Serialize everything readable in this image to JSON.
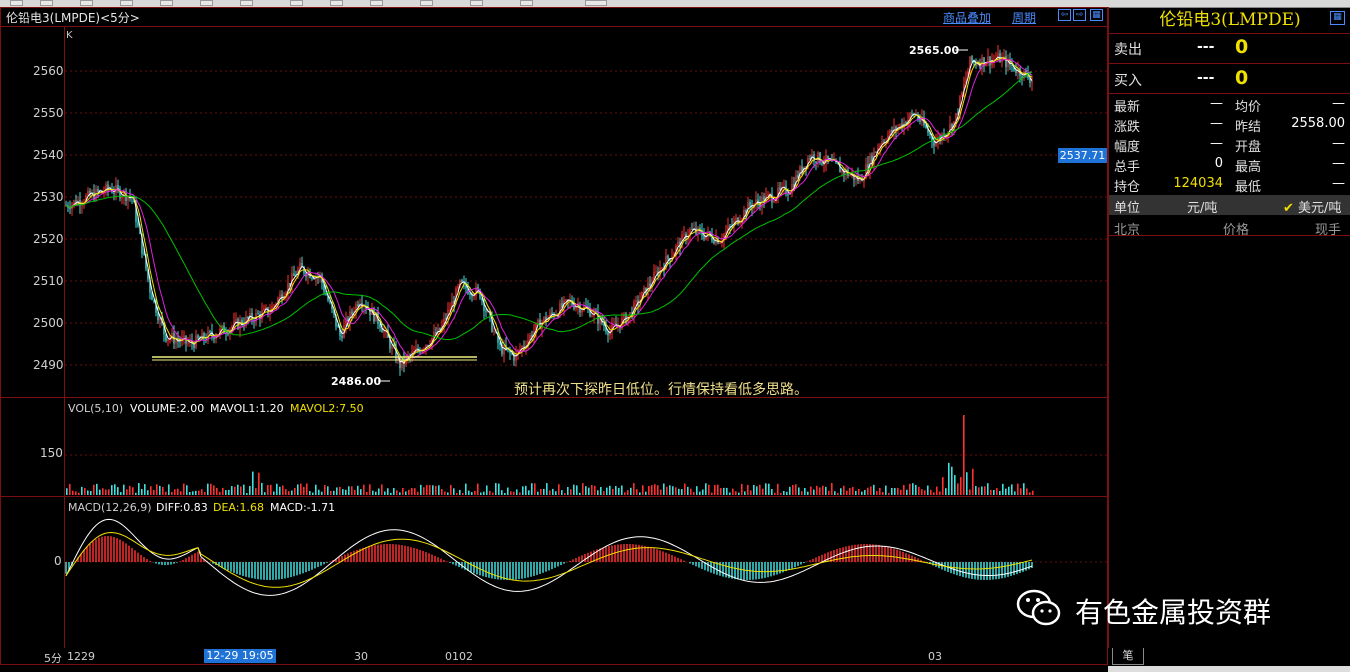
{
  "window": {
    "title": "伦铅电3(LMPDE)<5分>",
    "overlay_link": "商品叠加",
    "period_link": "周期"
  },
  "chart": {
    "k_label": "K",
    "y_ticks": [
      "2560",
      "2550",
      "2540",
      "2530",
      "2520",
      "2510",
      "2500",
      "2490"
    ],
    "high_annotation": "2565.00",
    "low_annotation": "2486.00",
    "note": "预计再次下探昨日低位。行情保持看低多思路。",
    "current_price": "2537.71",
    "colors": {
      "up": "#ff3030",
      "down": "#40e0e0",
      "ma5": "#ffffff",
      "ma10": "#f0e000",
      "ma20": "#e020e0",
      "ma60": "#00c000",
      "support": "#f0f080"
    }
  },
  "volume": {
    "label": "VOL(5,10)",
    "volume": "VOLUME:2.00",
    "mavol1": "MAVOL1:1.20",
    "mavol2": "MAVOL2:7.50",
    "tick": "150"
  },
  "macd": {
    "label": "MACD(12,26,9)",
    "diff": "DIFF:0.83",
    "dea": "DEA:1.68",
    "macd": "MACD:-1.71",
    "tick": "0"
  },
  "x_axis": {
    "period": "5分",
    "labels": [
      "1229",
      "30",
      "0102",
      "03"
    ],
    "selected_time": "12-29 19:05"
  },
  "quote": {
    "name": "伦铅电3(LMPDE)",
    "sell_label": "卖出",
    "sell_dash": "---",
    "sell_value": "0",
    "buy_label": "买入",
    "buy_dash": "---",
    "buy_value": "0",
    "rows": [
      {
        "l1": "最新",
        "v1": "—",
        "l2": "均价",
        "v2": "—"
      },
      {
        "l1": "涨跌",
        "v1": "—",
        "l2": "昨结",
        "v2": "2558.00"
      },
      {
        "l1": "幅度",
        "v1": "—",
        "l2": "开盘",
        "v2": "—"
      },
      {
        "l1": "总手",
        "v1": "0",
        "l2": "最高",
        "v2": "—"
      },
      {
        "l1": "持仓",
        "v1": "124034",
        "l2": "最低",
        "v2": "—"
      }
    ],
    "unit_label": "单位",
    "unit_value": "元/吨",
    "unit_alt": "美元/吨",
    "columns": [
      "北京",
      "价格",
      "现手"
    ],
    "tab": "笔"
  },
  "watermark": "有色金属投资群"
}
